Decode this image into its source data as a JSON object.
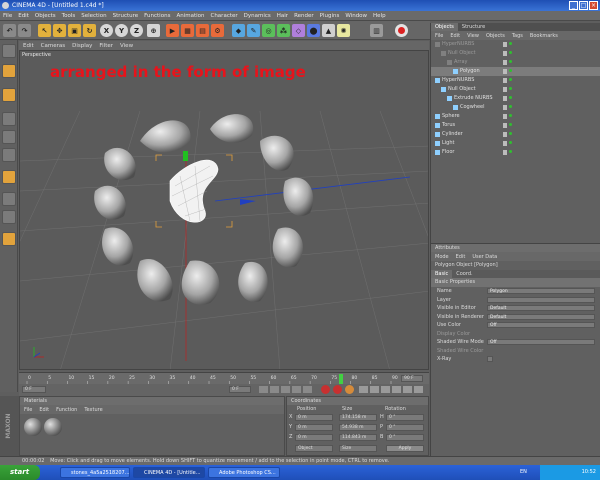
{
  "window": {
    "title": "CINEMA 4D - [Untitled 1.c4d *]"
  },
  "menubar": [
    "File",
    "Edit",
    "Objects",
    "Tools",
    "Selection",
    "Structure",
    "Functions",
    "Animation",
    "Character",
    "Dynamics",
    "Hair",
    "Render",
    "Plugins",
    "Window",
    "Help"
  ],
  "viewport": {
    "menu": [
      "Edit",
      "Cameras",
      "Display",
      "Filter",
      "View"
    ],
    "label": "Perspective",
    "annotation": "arranged in the form of image"
  },
  "objects_panel": {
    "tabs": [
      "Objects",
      "Structure"
    ],
    "menu": [
      "File",
      "Edit",
      "View",
      "Objects",
      "Tags",
      "Bookmarks"
    ],
    "tree": [
      {
        "name": "HyperNURBS",
        "indent": 0,
        "muted": true
      },
      {
        "name": "Null Object",
        "indent": 1,
        "muted": true
      },
      {
        "name": "Array",
        "indent": 2,
        "muted": true
      },
      {
        "name": "Polygon",
        "indent": 3,
        "muted": false,
        "selected": true
      },
      {
        "name": "HyperNURBS",
        "indent": 0,
        "muted": false
      },
      {
        "name": "Null Object",
        "indent": 1,
        "muted": false
      },
      {
        "name": "Extrude NURBS",
        "indent": 2,
        "muted": false
      },
      {
        "name": "Cogwheel",
        "indent": 3,
        "muted": false
      },
      {
        "name": "Sphere",
        "indent": 0,
        "muted": false
      },
      {
        "name": "Torus",
        "indent": 0,
        "muted": false
      },
      {
        "name": "Cylinder",
        "indent": 0,
        "muted": false
      },
      {
        "name": "Light",
        "indent": 0,
        "muted": false
      },
      {
        "name": "Floor",
        "indent": 0,
        "muted": false
      }
    ]
  },
  "attributes_panel": {
    "header": "Attributes",
    "menu": [
      "Mode",
      "Edit",
      "User Data"
    ],
    "object_title": "Polygon Object [Polygon]",
    "tabs": [
      "Basic",
      "Coord."
    ],
    "section": "Basic Properties",
    "rows": [
      {
        "label": "Name",
        "value": "Polygon"
      },
      {
        "label": "Layer",
        "value": ""
      },
      {
        "label": "Visible in Editor",
        "value": "Default"
      },
      {
        "label": "Visible in Renderer",
        "value": "Default"
      },
      {
        "label": "Use Color",
        "value": "Off"
      },
      {
        "label": "Display Color",
        "value": ""
      },
      {
        "label": "Shaded Wire Mode",
        "value": "Off"
      },
      {
        "label": "Shaded Wire Color",
        "value": ""
      },
      {
        "label": "X-Ray",
        "value": ""
      }
    ]
  },
  "materials": {
    "header": "Materials",
    "menu": [
      "File",
      "Edit",
      "Function",
      "Texture"
    ]
  },
  "coordinates": {
    "header": "Coordinates",
    "columns": [
      "Position",
      "Size",
      "Rotation"
    ],
    "rows": [
      {
        "axis": "X",
        "pos": "0 m",
        "size": "174.158 m",
        "rl": "H",
        "rot": "0 °"
      },
      {
        "axis": "Y",
        "pos": "0 m",
        "size": "54.938 m",
        "rl": "P",
        "rot": "0 °"
      },
      {
        "axis": "Z",
        "pos": "0 m",
        "size": "114.843 m",
        "rl": "B",
        "rot": "0 °"
      }
    ],
    "mode_left": "Object",
    "mode_mid": "Size",
    "apply": "Apply"
  },
  "timeline": {
    "ticks": [
      "0",
      "5",
      "10",
      "15",
      "20",
      "25",
      "30",
      "35",
      "40",
      "45",
      "50",
      "55",
      "60",
      "65",
      "70",
      "75",
      "80",
      "85",
      "90"
    ],
    "end_field": "90 F",
    "start_field": "0 F",
    "frame_field": "0 F",
    "end_field2": "90 F"
  },
  "status": {
    "time": "00:00:02",
    "message": "Move: Click and drag to move elements. Hold down SHIFT to quantize movement / add to the selection in point mode, CTRL to remove."
  },
  "taskbar": {
    "start": "start",
    "items": [
      "stones_4a5a2518207...",
      "CINEMA 4D - [Untitle...",
      "Adobe Photoshop CS..."
    ],
    "tray_time": "10:52",
    "lang": "EN"
  },
  "colors": {
    "annotation": "#e8131b",
    "accent_blue": "#1f4fb4"
  }
}
